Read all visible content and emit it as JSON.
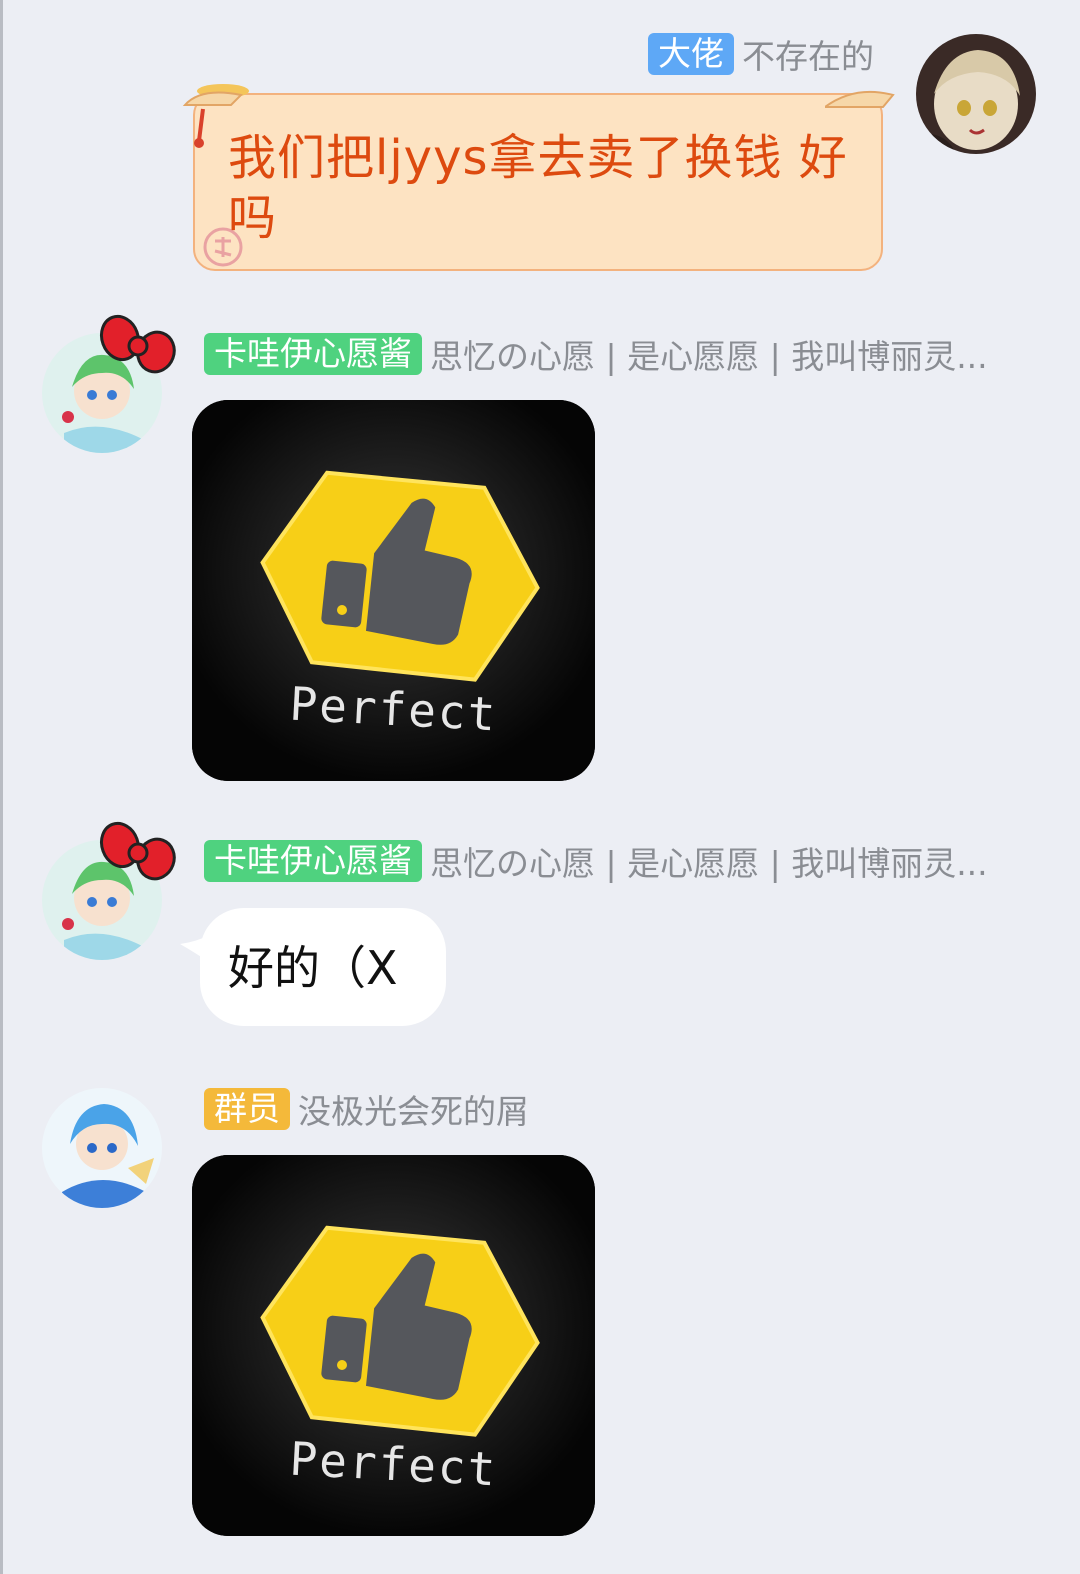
{
  "messages": [
    {
      "badge": "大佬",
      "badge_color": "#5ea8f6",
      "nickname": "不存在的",
      "text": "我们把ljyys拿去卖了换钱 好吗",
      "text_color": "#dd4a0f"
    },
    {
      "badge": "卡哇伊心愿酱",
      "badge_color": "#4fd27f",
      "nickname": "思忆の心愿 | 是心愿愿 | 我叫博丽灵...",
      "sticker_label": "Perfect"
    },
    {
      "badge": "卡哇伊心愿酱",
      "badge_color": "#4fd27f",
      "nickname": "思忆の心愿 | 是心愿愿 | 我叫博丽灵...",
      "text": "好的（X"
    },
    {
      "badge": "群员",
      "badge_color": "#f4b93a",
      "nickname": "没极光会死的屑",
      "sticker_label": "Perfect"
    }
  ]
}
